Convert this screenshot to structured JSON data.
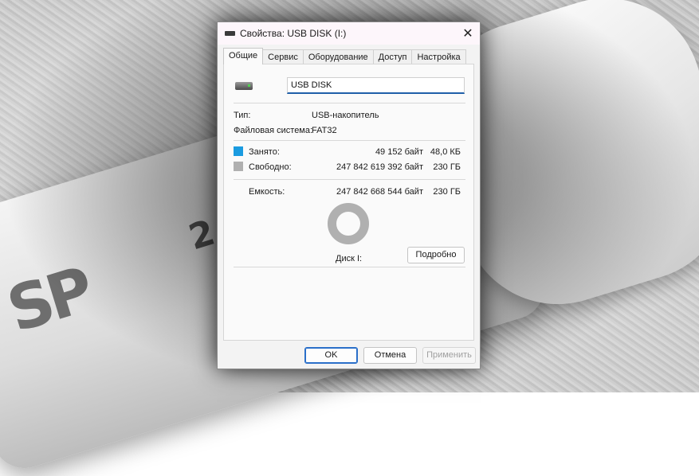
{
  "window": {
    "title": "Свойства: USB DISK (I:)",
    "close_glyph": "✕",
    "accent_color": "#1f5fa8"
  },
  "tabs": [
    {
      "label": "Общие",
      "active": true
    },
    {
      "label": "Сервис",
      "active": false
    },
    {
      "label": "Оборудование",
      "active": false
    },
    {
      "label": "Доступ",
      "active": false
    },
    {
      "label": "Настройка",
      "active": false
    }
  ],
  "general": {
    "drive_name": "USB DISK",
    "type_label": "Тип:",
    "type_value": "USB-накопитель",
    "fs_label": "Файловая система:",
    "fs_value": "FAT32",
    "used": {
      "label": "Занято:",
      "bytes": "49 152 байт",
      "size": "48,0 КБ",
      "color": "#1a9be0"
    },
    "free": {
      "label": "Свободно:",
      "bytes": "247 842 619 392 байт",
      "size": "230 ГБ",
      "color": "#b0b0b0"
    },
    "capacity": {
      "label": "Емкость:",
      "bytes": "247 842 668 544 байт",
      "size": "230 ГБ"
    },
    "disk_label": "Диск I:",
    "details_button": "Подробно",
    "used_fraction": 2e-07
  },
  "buttons": {
    "ok": "OK",
    "cancel": "Отмена",
    "apply": "Применить"
  }
}
